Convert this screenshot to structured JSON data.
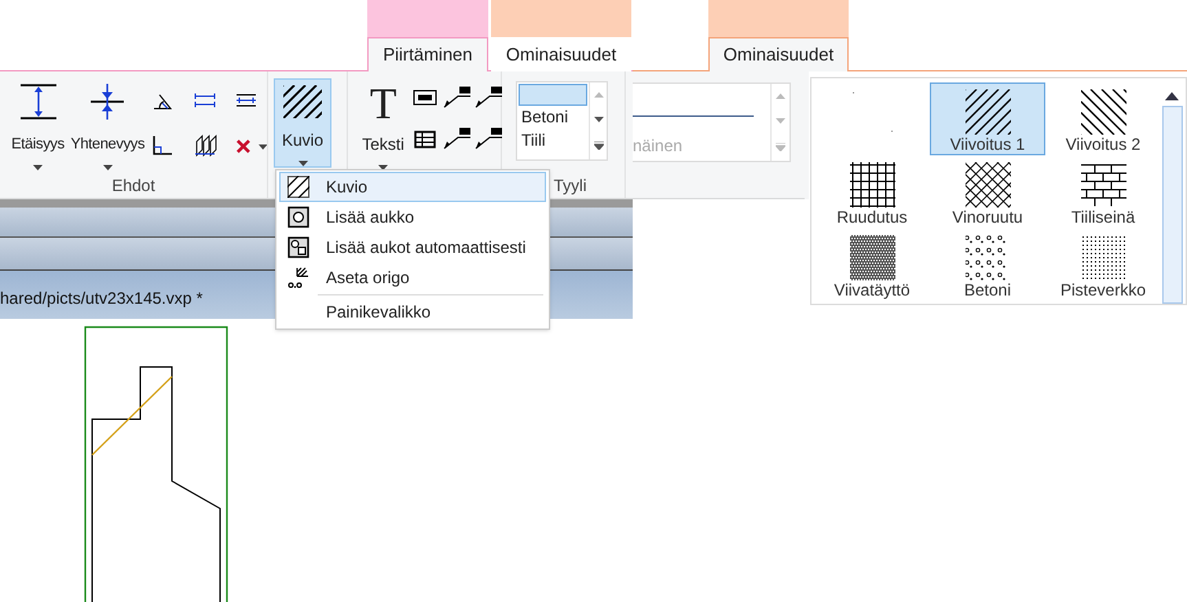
{
  "left_window": {
    "contextual_tabs": [
      {
        "label": "Piirtäminen",
        "color": "#fcc4de",
        "selected": true
      },
      {
        "label": "Ominaisuudet",
        "color": "#fdcfb5",
        "selected": false
      }
    ],
    "ehdot_group": {
      "label": "Ehdot",
      "buttons": [
        {
          "label": "Etäisyys",
          "kind": "distance"
        },
        {
          "label": "Yhtenevyys",
          "kind": "coincide"
        }
      ]
    },
    "pattern_button": {
      "label": "Kuvio",
      "selected": true
    },
    "text_button": {
      "label": "Teksti",
      "icon_glyph": "T"
    },
    "style_group": {
      "label": "Tyyli",
      "items": [
        {
          "label": "Betoni"
        },
        {
          "label": "Tiili"
        }
      ]
    },
    "dropdown_menu": [
      {
        "label": "Kuvio",
        "kind": "hatch",
        "selected": true
      },
      {
        "label": "Lisää aukko",
        "kind": "hole",
        "selected": false
      },
      {
        "label": "Lisää aukot automaattisesti",
        "kind": "holes",
        "selected": false
      },
      {
        "label": "Aseta origo",
        "kind": "origin",
        "selected": false
      },
      {
        "label": "Painikevalikko",
        "kind": "plain",
        "selected": false
      }
    ],
    "file_title": "hared/picts/utv23x145.vxp *"
  },
  "right_window": {
    "tab": {
      "label": "Ominaisuudet",
      "selected": true
    },
    "line_style_label": "näinen",
    "pattern_gallery": [
      {
        "kind": "none",
        "selected": false
      },
      {
        "label": "Viivoitus 1",
        "kind": "diag1",
        "selected": true
      },
      {
        "label": "Viivoitus 2",
        "kind": "diag2",
        "selected": false
      },
      {
        "label": "Ruudutus",
        "kind": "grid",
        "selected": false
      },
      {
        "label": "Vinoruutu",
        "kind": "crossdiag",
        "selected": false
      },
      {
        "label": "Tiiliseinä",
        "kind": "brick",
        "selected": false
      },
      {
        "label": "Viivatäyttö",
        "kind": "dense",
        "selected": false
      },
      {
        "label": "Betoni",
        "kind": "concrete",
        "selected": false
      },
      {
        "label": "Pisteverkko",
        "kind": "dots",
        "selected": false
      }
    ]
  }
}
